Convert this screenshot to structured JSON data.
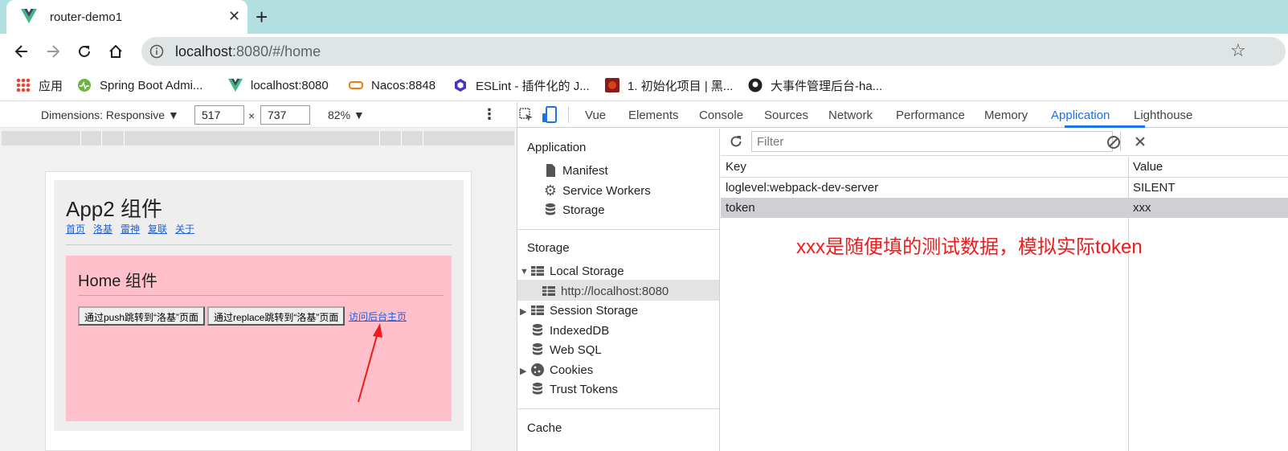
{
  "browser": {
    "tab_title": "router-demo1",
    "url_host": "localhost",
    "url_rest": ":8080/#/home"
  },
  "bookmarks": [
    {
      "label": "应用",
      "icon": "apps-grid-icon"
    },
    {
      "label": "Spring Boot Admi...",
      "icon": "spring-boot-admin-icon"
    },
    {
      "label": "localhost:8080",
      "icon": "vue-logo-icon"
    },
    {
      "label": "Nacos:8848",
      "icon": "nacos-icon"
    },
    {
      "label": "ESLint - 插件化的 J...",
      "icon": "eslint-icon"
    },
    {
      "label": "1. 初始化项目 | 黑...",
      "icon": "site-favicon"
    },
    {
      "label": "大事件管理后台-ha...",
      "icon": "github-icon"
    }
  ],
  "device_toolbar": {
    "dimensions_label": "Dimensions: Responsive ▼",
    "width": "517",
    "times": "×",
    "height": "737",
    "zoom": "82% ▼"
  },
  "app": {
    "title": "App2 组件",
    "nav_links": [
      "首页",
      "洛基",
      "雷神",
      "复联",
      "关于"
    ],
    "home_title": "Home 组件",
    "push_button": "通过push跳转到“洛基”页面",
    "replace_button": "通过replace跳转到“洛基”页面",
    "admin_link": "访问后台主页"
  },
  "devtools": {
    "tabs": [
      "Vue",
      "Elements",
      "Console",
      "Sources",
      "Network",
      "Performance",
      "Memory",
      "Application",
      "Lighthouse"
    ],
    "active_tab": "Application",
    "sidebar": {
      "application_header": "Application",
      "application_items": [
        "Manifest",
        "Service Workers",
        "Storage"
      ],
      "storage_header": "Storage",
      "local_storage": "Local Storage",
      "local_storage_origin": "http://localhost:8080",
      "storage_items": [
        "Session Storage",
        "IndexedDB",
        "Web SQL",
        "Cookies",
        "Trust Tokens"
      ],
      "cache_header": "Cache"
    },
    "filter_placeholder": "Filter",
    "table": {
      "headers": [
        "Key",
        "Value"
      ],
      "rows": [
        {
          "key": "loglevel:webpack-dev-server",
          "value": "SILENT"
        },
        {
          "key": "token",
          "value": "xxx"
        }
      ],
      "selected_row": 1
    }
  },
  "annotation": "xxx是随便填的测试数据，模拟实际token",
  "colors": {
    "tab_bar": "#b2e0e0",
    "accent": "#1a73e8",
    "annotation": "#ee1c1c",
    "home_bg": "#ffc0cb"
  }
}
